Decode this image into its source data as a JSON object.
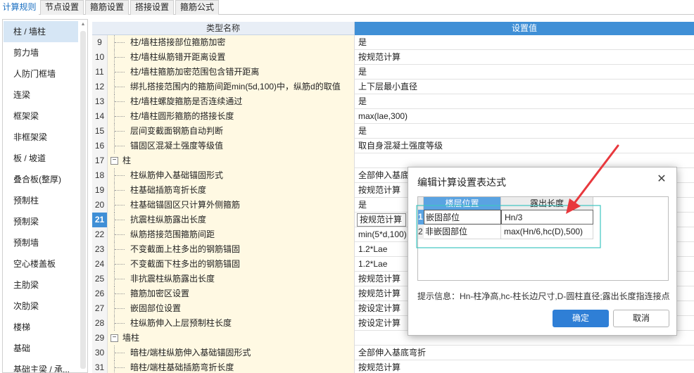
{
  "tabs": [
    "计算规则",
    "节点设置",
    "箍筋设置",
    "搭接设置",
    "箍筋公式"
  ],
  "sidebar": {
    "items": [
      "柱 / 墙柱",
      "剪力墙",
      "人防门框墙",
      "连梁",
      "框架梁",
      "非框架梁",
      "板 / 坡道",
      "叠合板(整厚)",
      "预制柱",
      "预制梁",
      "预制墙",
      "空心楼盖板",
      "主肋梁",
      "次肋梁",
      "楼梯",
      "基础",
      "基础主梁 / 承..."
    ]
  },
  "grid": {
    "header_type": "类型名称",
    "header_value": "设置值",
    "rows": [
      {
        "num": "9",
        "type": "柱/墙柱搭接部位箍筋加密",
        "value": "是"
      },
      {
        "num": "10",
        "type": "柱/墙柱纵筋错开距离设置",
        "value": "按规范计算"
      },
      {
        "num": "11",
        "type": "柱/墙柱箍筋加密范围包含错开距离",
        "value": "是"
      },
      {
        "num": "12",
        "type": "绑扎搭接范围内的箍筋间距min(5d,100)中，纵筋d的取值",
        "value": "上下层最小直径"
      },
      {
        "num": "13",
        "type": "柱/墙柱螺旋箍筋是否连续通过",
        "value": "是"
      },
      {
        "num": "14",
        "type": "柱/墙柱圆形箍筋的搭接长度",
        "value": "max(lae,300)"
      },
      {
        "num": "15",
        "type": "层间变截面钢筋自动判断",
        "value": "是"
      },
      {
        "num": "16",
        "type": "锚固区混凝土强度等级值",
        "value": "取自身混凝土强度等级"
      },
      {
        "num": "17",
        "type": "柱",
        "value": "",
        "group": true
      },
      {
        "num": "18",
        "type": "柱纵筋伸入基础锚固形式",
        "value": "全部伸入基底"
      },
      {
        "num": "19",
        "type": "柱基础插筋弯折长度",
        "value": "按规范计算"
      },
      {
        "num": "20",
        "type": "柱基础锚固区只计算外侧箍筋",
        "value": "是"
      },
      {
        "num": "21",
        "type": "抗震柱纵筋露出长度",
        "value": "按规范计算",
        "active": true
      },
      {
        "num": "22",
        "type": "纵筋搭接范围箍筋间距",
        "value": "min(5*d,100)"
      },
      {
        "num": "23",
        "type": "不变截面上柱多出的钢筋锚固",
        "value": "1.2*Lae"
      },
      {
        "num": "24",
        "type": "不变截面下柱多出的钢筋锚固",
        "value": "1.2*Lae"
      },
      {
        "num": "25",
        "type": "非抗震柱纵筋露出长度",
        "value": "按规范计算"
      },
      {
        "num": "26",
        "type": "箍筋加密区设置",
        "value": "按规范计算"
      },
      {
        "num": "27",
        "type": "嵌固部位设置",
        "value": "按设定计算"
      },
      {
        "num": "28",
        "type": "柱纵筋伸入上层预制柱长度",
        "value": "按设定计算"
      },
      {
        "num": "29",
        "type": "墙柱",
        "value": "",
        "group": true
      },
      {
        "num": "30",
        "type": "暗柱/端柱纵筋伸入基础锚固形式",
        "value": "全部伸入基底弯折"
      },
      {
        "num": "31",
        "type": "暗柱/端柱基础插筋弯折长度",
        "value": "按规范计算"
      }
    ]
  },
  "dialog": {
    "title": "编辑计算设置表达式",
    "close": "✕",
    "col1": "楼层位置",
    "col2": "露出长度",
    "rows": [
      {
        "num": "1",
        "pos": "嵌固部位",
        "len": "Hn/3"
      },
      {
        "num": "2",
        "pos": "非嵌固部位",
        "len": "max(Hn/6,hc(D),500)"
      }
    ],
    "hint": "提示信息：Hn-柱净高,hc-柱长边尺寸,D-圆柱直径;露出长度指连接点",
    "ok": "确定",
    "cancel": "取消"
  },
  "colors": {
    "accent": "#3f8fd6",
    "annotation": "#e8383d",
    "highlight": "#3ec6c0"
  }
}
